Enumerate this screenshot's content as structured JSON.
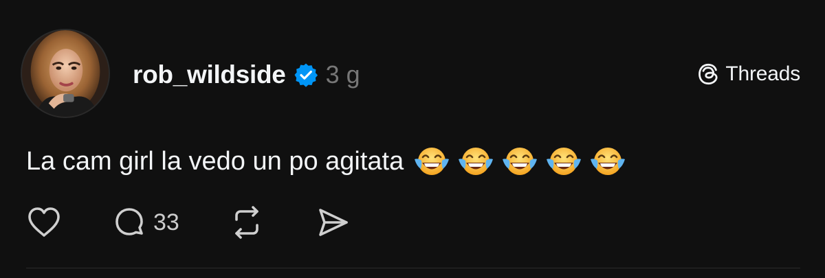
{
  "post": {
    "username": "rob_wildside",
    "verified_icon": "verified-badge-icon",
    "timestamp": "3 g",
    "text": "La cam girl la vedo un po agitata",
    "emojis": [
      "😂",
      "😂",
      "😂",
      "😂",
      "😂"
    ],
    "reply_count": "33"
  },
  "brand": {
    "logo_icon": "threads-logo-icon",
    "label": "Threads"
  },
  "actions": {
    "like_icon": "heart-icon",
    "reply_icon": "comment-icon",
    "repost_icon": "repost-icon",
    "share_icon": "send-icon"
  },
  "colors": {
    "background": "#101010",
    "text": "#f3f5f7",
    "muted": "#777777",
    "verified": "#0095f6"
  }
}
